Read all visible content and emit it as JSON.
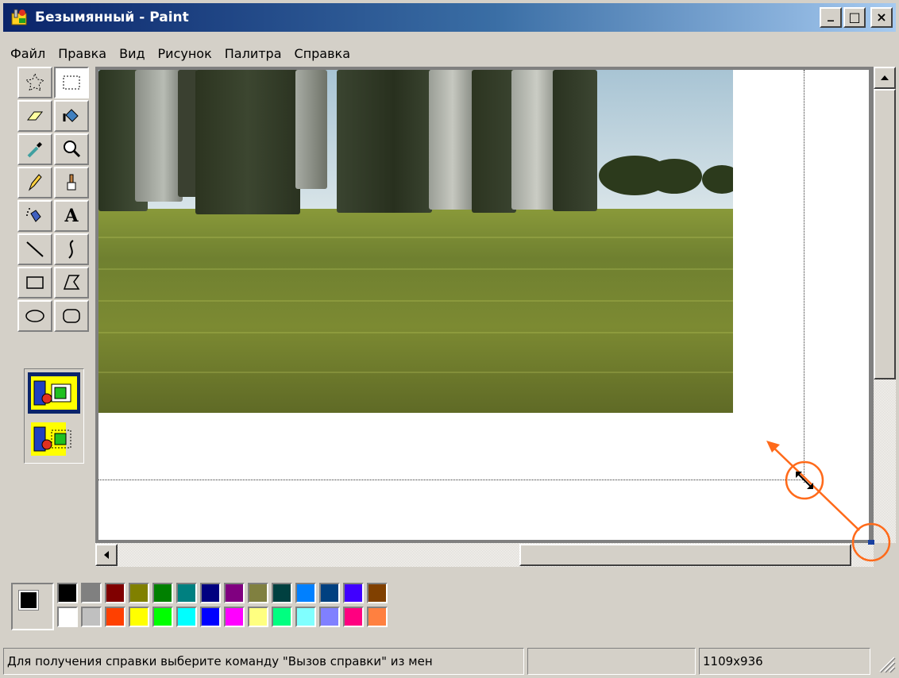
{
  "window": {
    "title": "Безымянный - Paint",
    "minimize_glyph": "_",
    "maximize_glyph": "□",
    "close_glyph": "×"
  },
  "menu": [
    "Файл",
    "Правка",
    "Вид",
    "Рисунок",
    "Палитра",
    "Справка"
  ],
  "toolbox": {
    "tools": [
      {
        "name": "free-form-select",
        "icon": "free-select-icon"
      },
      {
        "name": "rect-select",
        "icon": "rect-select-icon",
        "active": true
      },
      {
        "name": "eraser",
        "icon": "eraser-icon"
      },
      {
        "name": "fill",
        "icon": "fill-bucket-icon"
      },
      {
        "name": "pick-color",
        "icon": "eyedropper-icon"
      },
      {
        "name": "magnifier",
        "icon": "magnifier-icon"
      },
      {
        "name": "pencil",
        "icon": "pencil-icon"
      },
      {
        "name": "brush",
        "icon": "brush-icon"
      },
      {
        "name": "airbrush",
        "icon": "airbrush-icon"
      },
      {
        "name": "text",
        "icon": "text-icon"
      },
      {
        "name": "line",
        "icon": "line-icon"
      },
      {
        "name": "curve",
        "icon": "curve-icon"
      },
      {
        "name": "rectangle",
        "icon": "rectangle-icon"
      },
      {
        "name": "polygon",
        "icon": "polygon-icon"
      },
      {
        "name": "ellipse",
        "icon": "ellipse-icon"
      },
      {
        "name": "rounded-rect",
        "icon": "rounded-rect-icon"
      }
    ],
    "text_tool_glyph": "A",
    "options": [
      "opaque-selection",
      "transparent-selection"
    ]
  },
  "palette": {
    "foreground": "#000000",
    "background": "#ffffff",
    "row1": [
      "#000000",
      "#808080",
      "#800000",
      "#808000",
      "#008000",
      "#008080",
      "#000080",
      "#800080",
      "#808040",
      "#004040",
      "#0080ff",
      "#004080",
      "#4000ff",
      "#804000"
    ],
    "row2": [
      "#ffffff",
      "#c0c0c0",
      "#ff4000",
      "#ffff00",
      "#00ff00",
      "#00ffff",
      "#0000ff",
      "#ff00ff",
      "#ffff80",
      "#00ff80",
      "#80ffff",
      "#8080ff",
      "#ff0080",
      "#ff8040"
    ]
  },
  "status": {
    "help_text": "Для получения справки выберите команду \"Вызов справки\" из мен",
    "middle": "",
    "size": "1109x936"
  },
  "colors": {
    "title_start": "#0a246a",
    "title_end": "#a6caf0",
    "annotation": "#ff6a1a"
  }
}
